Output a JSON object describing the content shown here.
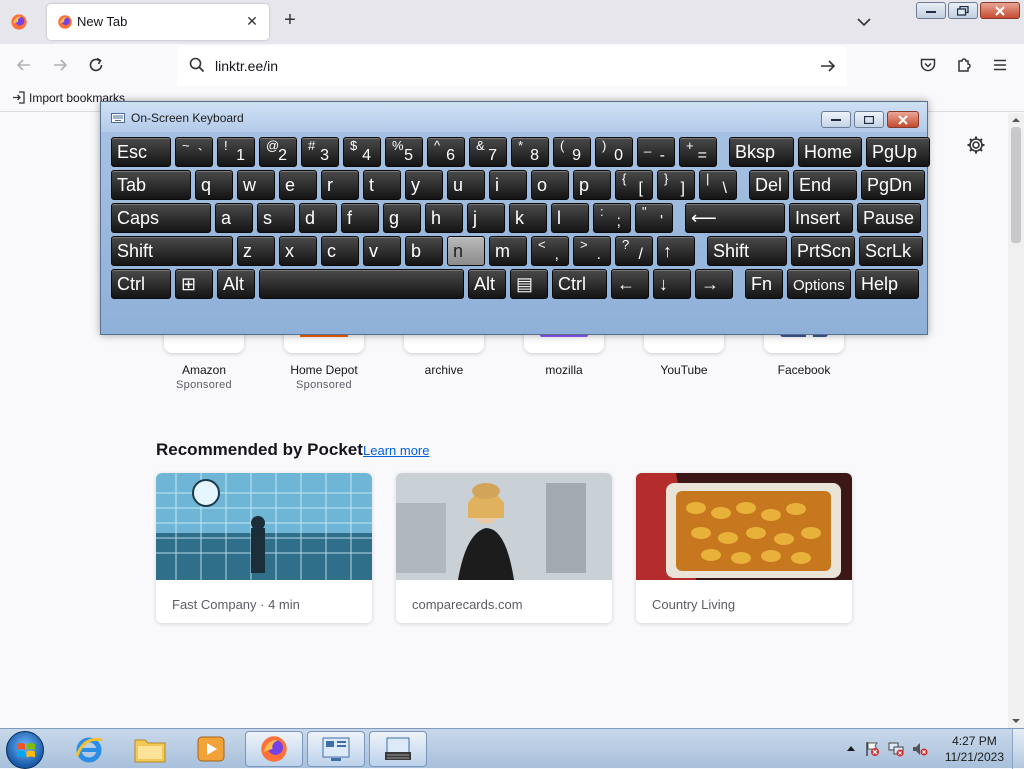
{
  "browser": {
    "tab": {
      "title": "New Tab"
    },
    "url": "linktr.ee/in",
    "bookmarks": {
      "import_label": "Import bookmarks"
    }
  },
  "osk": {
    "title": "On-Screen Keyboard",
    "rows": [
      [
        {
          "m": "Esc"
        },
        {
          "u": "~",
          "l": "`"
        },
        {
          "u": "!",
          "l": "1"
        },
        {
          "u": "@",
          "l": "2"
        },
        {
          "u": "#",
          "l": "3"
        },
        {
          "u": "$",
          "l": "4"
        },
        {
          "u": "%",
          "l": "5"
        },
        {
          "u": "^",
          "l": "6"
        },
        {
          "u": "&",
          "l": "7"
        },
        {
          "u": "*",
          "l": "8"
        },
        {
          "u": "(",
          "l": "9"
        },
        {
          "u": ")",
          "l": "0"
        },
        {
          "u": "_",
          "l": "-"
        },
        {
          "u": "+",
          "l": "="
        },
        {
          "m": "Bksp"
        },
        {
          "m": "Home"
        },
        {
          "m": "PgUp"
        }
      ],
      [
        {
          "m": "Tab"
        },
        {
          "m": "q"
        },
        {
          "m": "w"
        },
        {
          "m": "e"
        },
        {
          "m": "r"
        },
        {
          "m": "t"
        },
        {
          "m": "y"
        },
        {
          "m": "u"
        },
        {
          "m": "i"
        },
        {
          "m": "o"
        },
        {
          "m": "p"
        },
        {
          "u": "{",
          "l": "["
        },
        {
          "u": "}",
          "l": "]"
        },
        {
          "u": "|",
          "l": "\\"
        },
        {
          "m": "Del"
        },
        {
          "m": "End"
        },
        {
          "m": "PgDn"
        }
      ],
      [
        {
          "m": "Caps"
        },
        {
          "m": "a"
        },
        {
          "m": "s"
        },
        {
          "m": "d"
        },
        {
          "m": "f"
        },
        {
          "m": "g"
        },
        {
          "m": "h"
        },
        {
          "m": "j"
        },
        {
          "m": "k"
        },
        {
          "m": "l"
        },
        {
          "u": ":",
          "l": ";"
        },
        {
          "u": "\"",
          "l": "'"
        },
        {
          "m": "⟵"
        },
        {
          "m": "Insert"
        },
        {
          "m": "Pause"
        }
      ],
      [
        {
          "m": "Shift"
        },
        {
          "m": "z"
        },
        {
          "m": "x"
        },
        {
          "m": "c"
        },
        {
          "m": "v"
        },
        {
          "m": "b"
        },
        {
          "m": "n",
          "pressed": true
        },
        {
          "m": "m"
        },
        {
          "u": "<",
          "l": ","
        },
        {
          "u": ">",
          "l": "."
        },
        {
          "u": "?",
          "l": "/"
        },
        {
          "m": "↑"
        },
        {
          "m": "Shift"
        },
        {
          "m": "PrtScn"
        },
        {
          "m": "ScrLk"
        }
      ],
      [
        {
          "m": "Ctrl"
        },
        {
          "m": "⊞"
        },
        {
          "m": "Alt"
        },
        {
          "m": ""
        },
        {
          "m": "Alt"
        },
        {
          "m": "▤"
        },
        {
          "m": "Ctrl"
        },
        {
          "m": "←"
        },
        {
          "m": "↓"
        },
        {
          "m": "→"
        },
        {
          "m": "Fn"
        },
        {
          "m": "Options",
          "sm": true
        },
        {
          "m": "Help"
        }
      ]
    ]
  },
  "shortcuts": [
    {
      "label": "Amazon",
      "sponsor": "Sponsored",
      "icon": "amazon-icon"
    },
    {
      "label": "Home Depot",
      "sponsor": "Sponsored",
      "icon": "home-depot-icon"
    },
    {
      "label": "archive",
      "sponsor": "",
      "icon": "archive-icon"
    },
    {
      "label": "mozilla",
      "sponsor": "",
      "icon": "mozilla-icon"
    },
    {
      "label": "YouTube",
      "sponsor": "",
      "icon": "youtube-icon"
    },
    {
      "label": "Facebook",
      "sponsor": "",
      "icon": "facebook-icon"
    }
  ],
  "pocket": {
    "heading": "Recommended by Pocket",
    "learn_more": "Learn more",
    "cards": [
      {
        "source": "Fast Company · 4 min"
      },
      {
        "source": "comparecards.com"
      },
      {
        "source": "Country Living"
      }
    ]
  },
  "taskbar": {
    "time": "4:27 PM",
    "date": "11/21/2023"
  },
  "colors": {
    "accent_link": "#0061e0",
    "key_bg": "#1e1e1e",
    "osk_frame": "#9db9de"
  }
}
